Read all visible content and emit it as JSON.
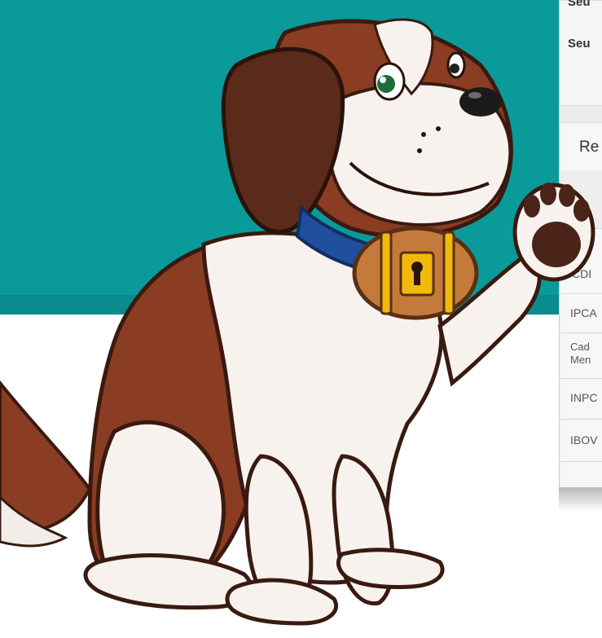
{
  "panel": {
    "row_label_top": "Seu",
    "row_label_2": "Seu",
    "card_title": "Re",
    "indices": [
      {
        "label": "CDI"
      },
      {
        "label": "IPCA"
      },
      {
        "label": "Cad"
      },
      {
        "label": "Men"
      },
      {
        "label": "INPC"
      },
      {
        "label": "IBOV"
      }
    ]
  },
  "colors": {
    "teal": "#0a9a9a",
    "dog_brown": "#8a3d22",
    "collar": "#1f4f9e",
    "barrel": "#c47a3a",
    "barrel_band": "#f2b90d"
  },
  "mascot": {
    "icon": "saint-bernard-dog-mascot-icon"
  }
}
